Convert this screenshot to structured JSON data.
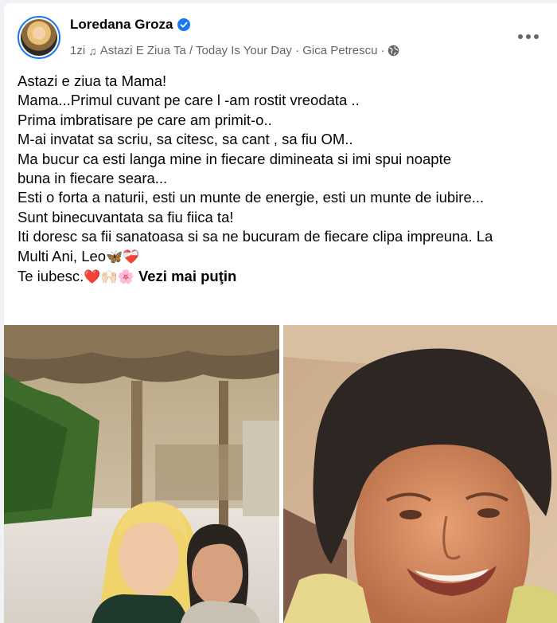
{
  "post": {
    "author": "Loredana Groza",
    "time": "1zi",
    "song": "Astazi E Ziua Ta / Today Is Your Day · Gica Petrescu",
    "separator": "·",
    "lines": [
      "Astazi e ziua ta Mama!",
      "Mama...Primul cuvant pe care l -am rostit vreodata ..",
      "Prima imbratisare pe care am primit-o..",
      "M-ai invatat sa scriu, sa citesc, sa cant , sa fiu OM..",
      "Ma bucur ca esti langa mine in fiecare dimineata  si imi spui noapte",
      "buna in fiecare seara...",
      "Esti o forta a naturii, esti un munte de energie, esti un munte de iubire...",
      " Sunt binecuvantata sa fiu fiica ta!",
      "Iti doresc sa fii sanatoasa si sa ne bucuram de fiecare clipa impreuna. La",
      "Multi Ani, Leo"
    ],
    "last_line": "Te iubesc.",
    "see_more": "Vezi mai puţin",
    "emoji_leo": "🦋❤️‍🩹",
    "emoji_love": "❤️🙌🏻🌸",
    "colors": {
      "brand": "#1877f2",
      "meta": "#65676b"
    },
    "icons": [
      "verified-badge-icon",
      "music-note-icon",
      "globe-icon",
      "more-options-icon"
    ]
  }
}
